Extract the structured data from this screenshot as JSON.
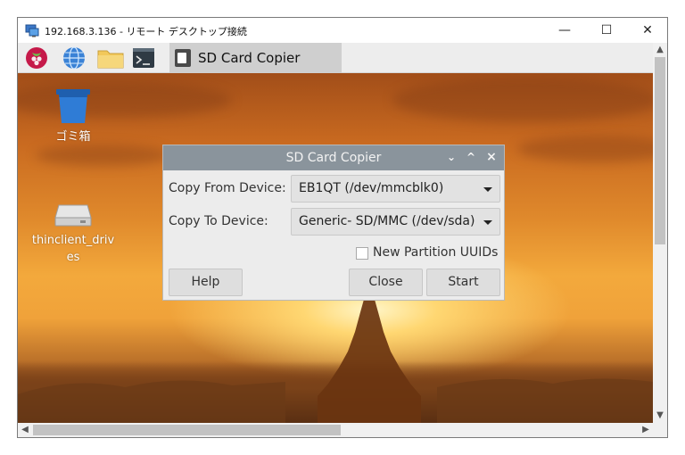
{
  "window": {
    "title": "192.168.3.136 - リモート デスクトップ接続",
    "minimize_glyph": "—",
    "maximize_glyph": "☐",
    "close_glyph": "✕"
  },
  "taskbar": {
    "icons": [
      "raspberry-icon",
      "web-browser-icon",
      "file-manager-icon",
      "terminal-icon"
    ],
    "active_window_label": "SD Card Copier"
  },
  "desktop": {
    "icons": [
      {
        "name": "trash",
        "label": "ゴミ箱"
      },
      {
        "name": "thinclient-drives",
        "label_line1": "thinclient_driv",
        "label_line2": "es"
      }
    ]
  },
  "dialog": {
    "title": "SD Card Copier",
    "controls": {
      "menu": "⌄",
      "maximize": "^",
      "close": "×"
    },
    "copy_from_label": "Copy From Device:",
    "copy_from_value": "EB1QT  (/dev/mmcblk0)",
    "copy_to_label": "Copy To Device:",
    "copy_to_value": "Generic- SD/MMC  (/dev/sda)",
    "checkbox_label": "New Partition UUIDs",
    "checkbox_checked": false,
    "buttons": {
      "help": "Help",
      "close": "Close",
      "start": "Start"
    }
  },
  "colors": {
    "dialog_titlebar": "#8a949c",
    "dialog_background": "#ececec",
    "taskbar_background": "#ededed"
  }
}
